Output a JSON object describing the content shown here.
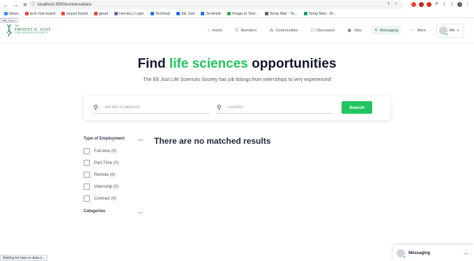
{
  "browser": {
    "url": "localhost:3000/conversations",
    "bookmarks": [
      {
        "label": "News",
        "color": "#4285f4"
      },
      {
        "label": "tech hub board",
        "color": "#ea4335"
      },
      {
        "label": "eejust board",
        "color": "#ea4335"
      },
      {
        "label": "gmail",
        "color": "#ea4335"
      },
      {
        "label": "Heroku | Login",
        "color": "#6762a6"
      },
      {
        "label": "TechHub",
        "color": "#1a73e8"
      },
      {
        "label": "EE Just",
        "color": "#1a73e8"
      },
      {
        "label": "TechHub",
        "color": "#1a73e8"
      },
      {
        "label": "Image to Text...",
        "color": "#34a853"
      },
      {
        "label": "Temp Mail - Te...",
        "color": "#5f6368"
      },
      {
        "label": "Temp Mail - Di...",
        "color": "#0f9d58"
      }
    ]
  },
  "loading_tip": "SRI_2 bo. r ",
  "logo": {
    "the": "The",
    "name": "ERNEST E. JUST",
    "sub": "LIFE SCIENCE SOCIETY"
  },
  "nav": {
    "items": [
      {
        "label": "Home",
        "icon": "home-icon",
        "glyph": "⌂"
      },
      {
        "label": "Members",
        "icon": "members-icon",
        "glyph": "☷"
      },
      {
        "label": "Communities",
        "icon": "communities-icon",
        "glyph": "⁂"
      },
      {
        "label": "Discussion",
        "icon": "discussion-icon",
        "glyph": "☐"
      },
      {
        "label": "Jobs",
        "icon": "jobs-icon",
        "glyph": "▣"
      },
      {
        "label": "Messaging",
        "icon": "messaging-icon",
        "glyph": "✈"
      },
      {
        "label": "More",
        "icon": "more-icon",
        "glyph": "⋯"
      }
    ],
    "active": "Messaging",
    "me_label": "Me"
  },
  "hero": {
    "title_pre": "Find ",
    "title_accent": "life sciences",
    "title_post": " opportunities",
    "subtitle": "The EE Just Life Sciences Society has job listings from internships to very experienced"
  },
  "search": {
    "job_placeholder": "Job title or keyword",
    "location_placeholder": "Location",
    "button_label": "Search"
  },
  "filters": {
    "employment_title": "Type of Employment",
    "options": [
      "Full-time (0)",
      "Part-Time (0)",
      "Remote (0)",
      "Internship (0)",
      "Contract (0)"
    ],
    "categories_title": "Categories"
  },
  "results": {
    "empty_message": "There are no matched results"
  },
  "status_bar": "Waiting for bam.nr-data.n...",
  "messaging_widget": {
    "label": "Messaging"
  },
  "colors": {
    "accent": "#22c55e",
    "active_nav_bg": "#eef6f1"
  }
}
